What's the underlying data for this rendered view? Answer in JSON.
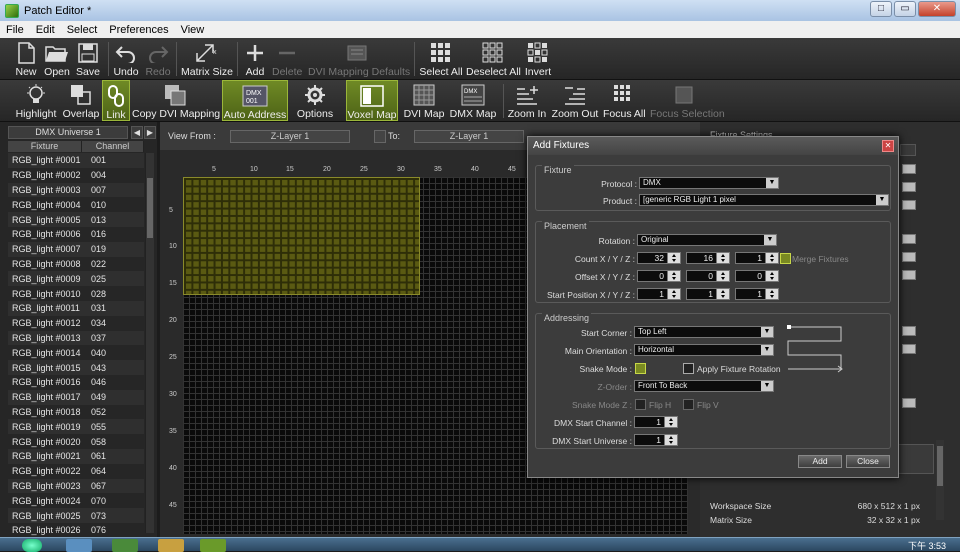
{
  "window": {
    "title": "Patch Editor *",
    "buttons": [
      "□",
      "▭",
      "✕"
    ]
  },
  "menu": [
    "File",
    "Edit",
    "Select",
    "Preferences",
    "View"
  ],
  "toolbar1": [
    {
      "label": "New",
      "icon": "new-file-icon",
      "enabled": true
    },
    {
      "label": "Open",
      "icon": "folder-open-icon",
      "enabled": true
    },
    {
      "label": "Save",
      "icon": "floppy-disk-icon",
      "enabled": true
    },
    {
      "label": "Undo",
      "icon": "undo-arrow-icon",
      "enabled": true
    },
    {
      "label": "Redo",
      "icon": "redo-arrow-icon",
      "enabled": false
    },
    {
      "label": "Matrix Size",
      "icon": "matrix-size-icon",
      "enabled": true
    },
    {
      "label": "Add",
      "icon": "plus-icon",
      "enabled": true
    },
    {
      "label": "Delete",
      "icon": "minus-icon",
      "enabled": false
    },
    {
      "label": "DVI Mapping Defaults",
      "icon": "dvi-defaults-icon",
      "enabled": false
    },
    {
      "label": "Select All",
      "icon": "select-all-grid-icon",
      "enabled": true
    },
    {
      "label": "Deselect All",
      "icon": "deselect-all-grid-icon",
      "enabled": true
    },
    {
      "label": "Invert",
      "icon": "invert-grid-icon",
      "enabled": true
    }
  ],
  "toolbar2": [
    {
      "label": "Highlight",
      "icon": "lightbulb-icon",
      "enabled": true,
      "active": false
    },
    {
      "label": "Overlap",
      "icon": "overlap-icon",
      "enabled": true,
      "active": false
    },
    {
      "label": "Link",
      "icon": "chain-link-icon",
      "enabled": true,
      "active": true
    },
    {
      "label": "Copy DVI Mapping",
      "icon": "copy-dvi-icon",
      "enabled": true,
      "active": false
    },
    {
      "label": "Auto Address",
      "icon": "auto-address-icon",
      "enabled": true,
      "active": true
    },
    {
      "label": "Options",
      "icon": "gear-icon",
      "enabled": true,
      "active": false
    },
    {
      "label": "Voxel Map",
      "icon": "voxel-map-icon",
      "enabled": true,
      "active": true
    },
    {
      "label": "DVI Map",
      "icon": "dvi-map-icon",
      "enabled": true,
      "active": false
    },
    {
      "label": "DMX Map",
      "icon": "dmx-map-icon",
      "enabled": true,
      "active": false
    },
    {
      "label": "Zoom In",
      "icon": "zoom-in-icon",
      "enabled": true,
      "active": false
    },
    {
      "label": "Zoom Out",
      "icon": "zoom-out-icon",
      "enabled": true,
      "active": false
    },
    {
      "label": "Focus All",
      "icon": "focus-all-icon",
      "enabled": true,
      "active": false
    },
    {
      "label": "Focus Selection",
      "icon": "focus-selection-icon",
      "enabled": false,
      "active": false
    }
  ],
  "left": {
    "universe": "DMX Universe 1",
    "col_fixture": "Fixture",
    "col_channel": "Channel",
    "rows": [
      [
        "RGB_light #0001",
        "001"
      ],
      [
        "RGB_light #0002",
        "004"
      ],
      [
        "RGB_light #0003",
        "007"
      ],
      [
        "RGB_light #0004",
        "010"
      ],
      [
        "RGB_light #0005",
        "013"
      ],
      [
        "RGB_light #0006",
        "016"
      ],
      [
        "RGB_light #0007",
        "019"
      ],
      [
        "RGB_light #0008",
        "022"
      ],
      [
        "RGB_light #0009",
        "025"
      ],
      [
        "RGB_light #0010",
        "028"
      ],
      [
        "RGB_light #0011",
        "031"
      ],
      [
        "RGB_light #0012",
        "034"
      ],
      [
        "RGB_light #0013",
        "037"
      ],
      [
        "RGB_light #0014",
        "040"
      ],
      [
        "RGB_light #0015",
        "043"
      ],
      [
        "RGB_light #0016",
        "046"
      ],
      [
        "RGB_light #0017",
        "049"
      ],
      [
        "RGB_light #0018",
        "052"
      ],
      [
        "RGB_light #0019",
        "055"
      ],
      [
        "RGB_light #0020",
        "058"
      ],
      [
        "RGB_light #0021",
        "061"
      ],
      [
        "RGB_light #0022",
        "064"
      ],
      [
        "RGB_light #0023",
        "067"
      ],
      [
        "RGB_light #0024",
        "070"
      ],
      [
        "RGB_light #0025",
        "073"
      ],
      [
        "RGB_light #0026",
        "076"
      ]
    ]
  },
  "view": {
    "view_from_label": "View From :",
    "view_from_value": "Z-Layer 1",
    "to_label": "To:",
    "to_value": "Z-Layer 1",
    "x_ticks": [
      "5",
      "10",
      "15",
      "20",
      "25",
      "30",
      "35",
      "40",
      "45"
    ],
    "y_ticks": [
      "5",
      "10",
      "15",
      "20",
      "25",
      "30",
      "35",
      "40",
      "45"
    ]
  },
  "right": {
    "header": "Fixture Settings",
    "workspace_label": "Workspace Size",
    "workspace_value": "680 x 512 x 1 px",
    "matrix_label": "Matrix Size",
    "matrix_value": "32 x 32 x 1 px"
  },
  "dialog": {
    "title": "Add Fixtures",
    "fixture_group": "Fixture",
    "protocol_label": "Protocol :",
    "protocol_value": "DMX",
    "product_label": "Product :",
    "product_value": "[generic RGB Light 1 pixel",
    "placement_group": "Placement",
    "rotation_label": "Rotation :",
    "rotation_value": "Original",
    "count_label": "Count X / Y / Z :",
    "count": [
      "32",
      "16",
      "1"
    ],
    "merge_label": "Merge Fixtures",
    "offset_label": "Offset X / Y / Z :",
    "offset": [
      "0",
      "0",
      "0"
    ],
    "startpos_label": "Start Position X / Y / Z :",
    "startpos": [
      "1",
      "1",
      "1"
    ],
    "addressing_group": "Addressing",
    "corner_label": "Start Corner :",
    "corner_value": "Top Left",
    "orient_label": "Main Orientation :",
    "orient_value": "Horizontal",
    "snake_label": "Snake Mode :",
    "apply_rot_label": "Apply Fixture Rotation",
    "zorder_label": "Z-Order :",
    "zorder_value": "Front To Back",
    "snakez_label": "Snake Mode Z :",
    "fliph_label": "Flip H",
    "flipv_label": "Flip V",
    "dmx_channel_label": "DMX Start Channel :",
    "dmx_channel_value": "1",
    "dmx_universe_label": "DMX Start Universe :",
    "dmx_universe_value": "1",
    "add_button": "Add",
    "close_button": "Close"
  },
  "taskbar": {
    "clock": "下午 3:53"
  }
}
